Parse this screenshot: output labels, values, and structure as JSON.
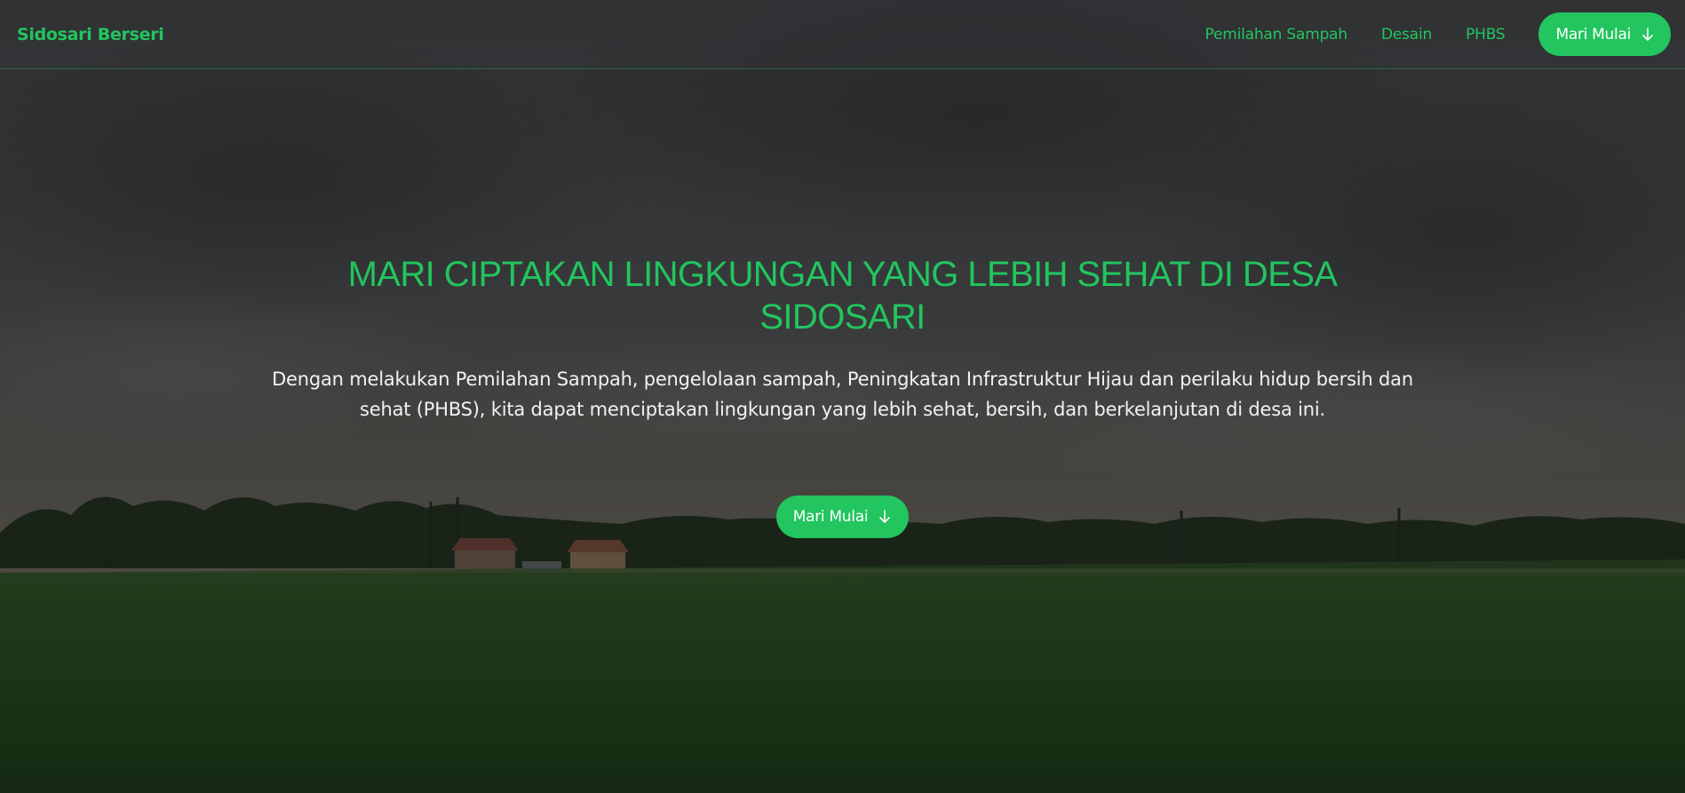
{
  "navbar": {
    "brand": "Sidosari Berseri",
    "links": [
      "Pemilahan Sampah",
      "Desain",
      "PHBS"
    ],
    "cta_label": "Mari Mulai",
    "cta_icon": "arrow-down-icon"
  },
  "hero": {
    "title": "MARI CIPTAKAN LINGKUNGAN YANG LEBIH SEHAT DI DESA SIDOSARI",
    "description": "Dengan melakukan Pemilahan Sampah, pengelolaan sampah, Peningkatan Infrastruktur Hijau dan perilaku hidup bersih dan sehat (PHBS), kita dapat menciptakan lingkungan yang lebih sehat, bersih, dan berkelanjutan di desa ini.",
    "cta_label": "Mari Mulai",
    "cta_icon": "arrow-down-icon",
    "background": "rice-field-landscape-image"
  },
  "colors": {
    "accent": "#22c55e",
    "text_light": "#f2f2f2"
  }
}
